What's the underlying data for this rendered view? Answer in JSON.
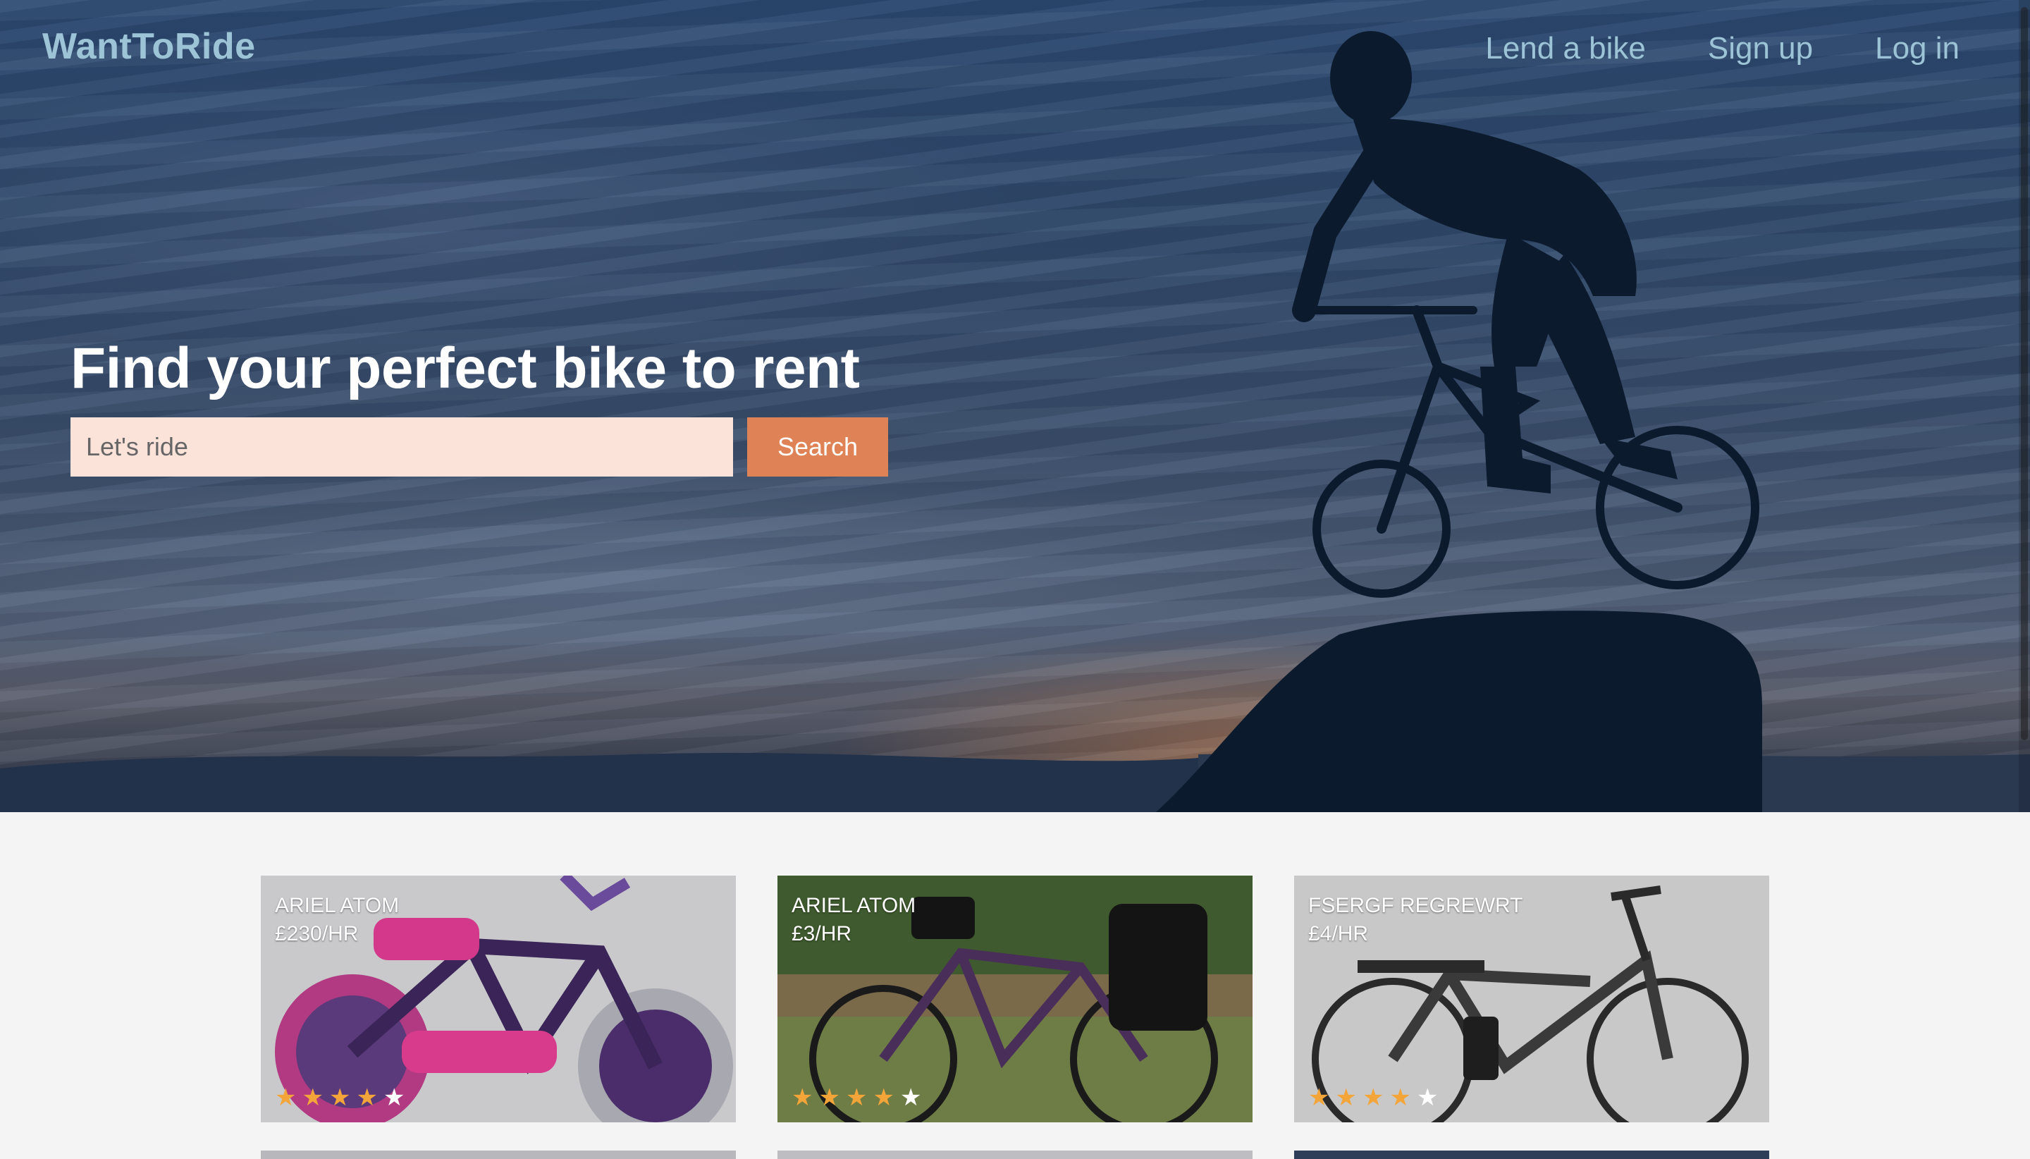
{
  "brand": "WantToRide",
  "nav": {
    "lend": "Lend a bike",
    "signup": "Sign up",
    "login": "Log in"
  },
  "hero": {
    "headline": "Find your perfect bike to rent",
    "search_placeholder": "Let's ride",
    "search_button": "Search"
  },
  "listings": [
    {
      "title": "Ariel Atom",
      "price": "£230/HR",
      "rating": 4
    },
    {
      "title": "Ariel Atom",
      "price": "£3/HR",
      "rating": 4
    },
    {
      "title": "FSERGF REGREWRT",
      "price": "£4/HR",
      "rating": 4
    }
  ],
  "colors": {
    "brand": "#9cc4d6",
    "accent": "#df8255",
    "star": "#f4a53a"
  }
}
